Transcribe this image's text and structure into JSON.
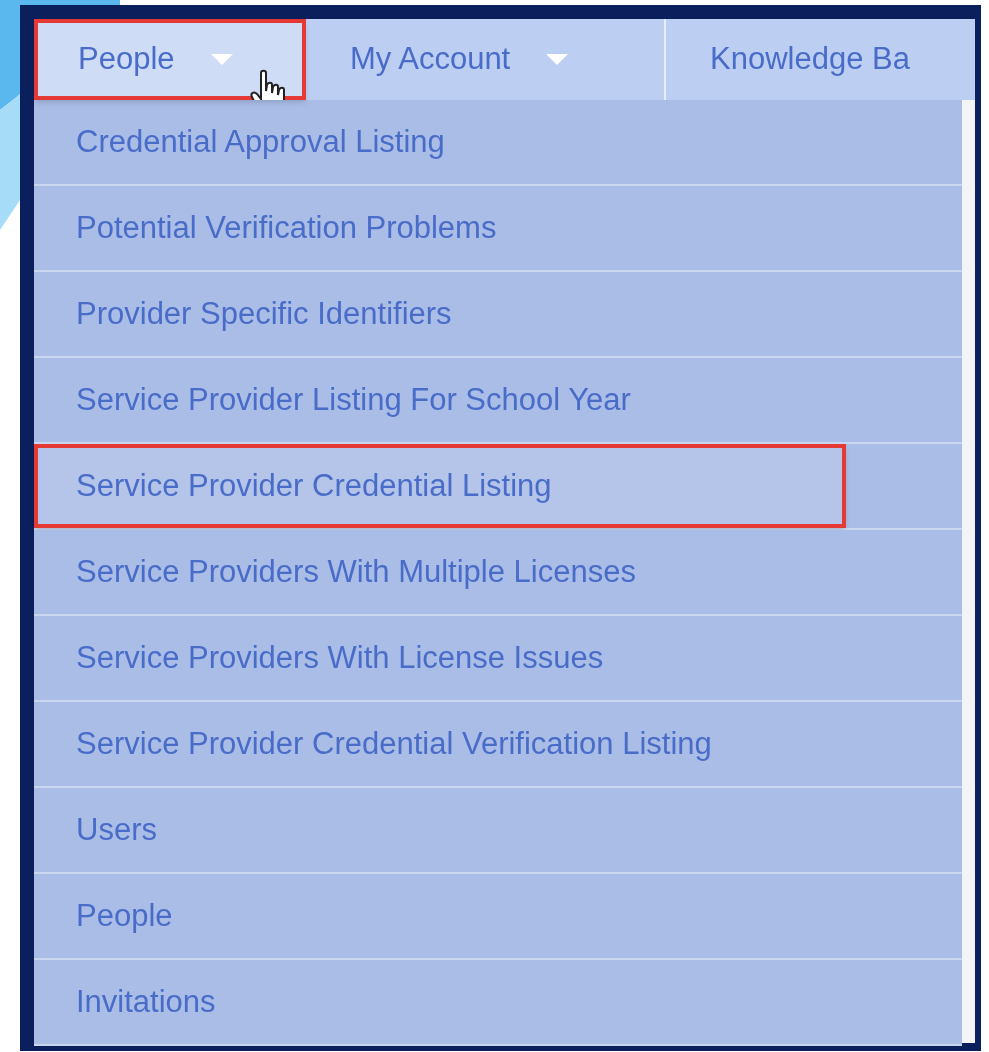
{
  "nav": {
    "tabs": [
      {
        "label": "People",
        "has_caret": true,
        "highlighted": true
      },
      {
        "label": "My Account",
        "has_caret": true,
        "highlighted": false
      },
      {
        "label": "Knowledge Ba",
        "has_caret": false,
        "highlighted": false
      }
    ]
  },
  "dropdown": {
    "items": [
      {
        "label": "Credential Approval Listing",
        "highlighted": false
      },
      {
        "label": "Potential Verification Problems",
        "highlighted": false
      },
      {
        "label": "Provider Specific Identifiers",
        "highlighted": false
      },
      {
        "label": "Service Provider Listing For School Year",
        "highlighted": false
      },
      {
        "label": "Service Provider Credential Listing",
        "highlighted": true
      },
      {
        "label": "Service Providers With Multiple Licenses",
        "highlighted": false
      },
      {
        "label": "Service Providers With License Issues",
        "highlighted": false
      },
      {
        "label": "Service Provider Credential Verification Listing",
        "highlighted": false
      },
      {
        "label": "Users",
        "highlighted": false
      },
      {
        "label": "People",
        "highlighted": false
      },
      {
        "label": "Invitations",
        "highlighted": false
      }
    ]
  }
}
